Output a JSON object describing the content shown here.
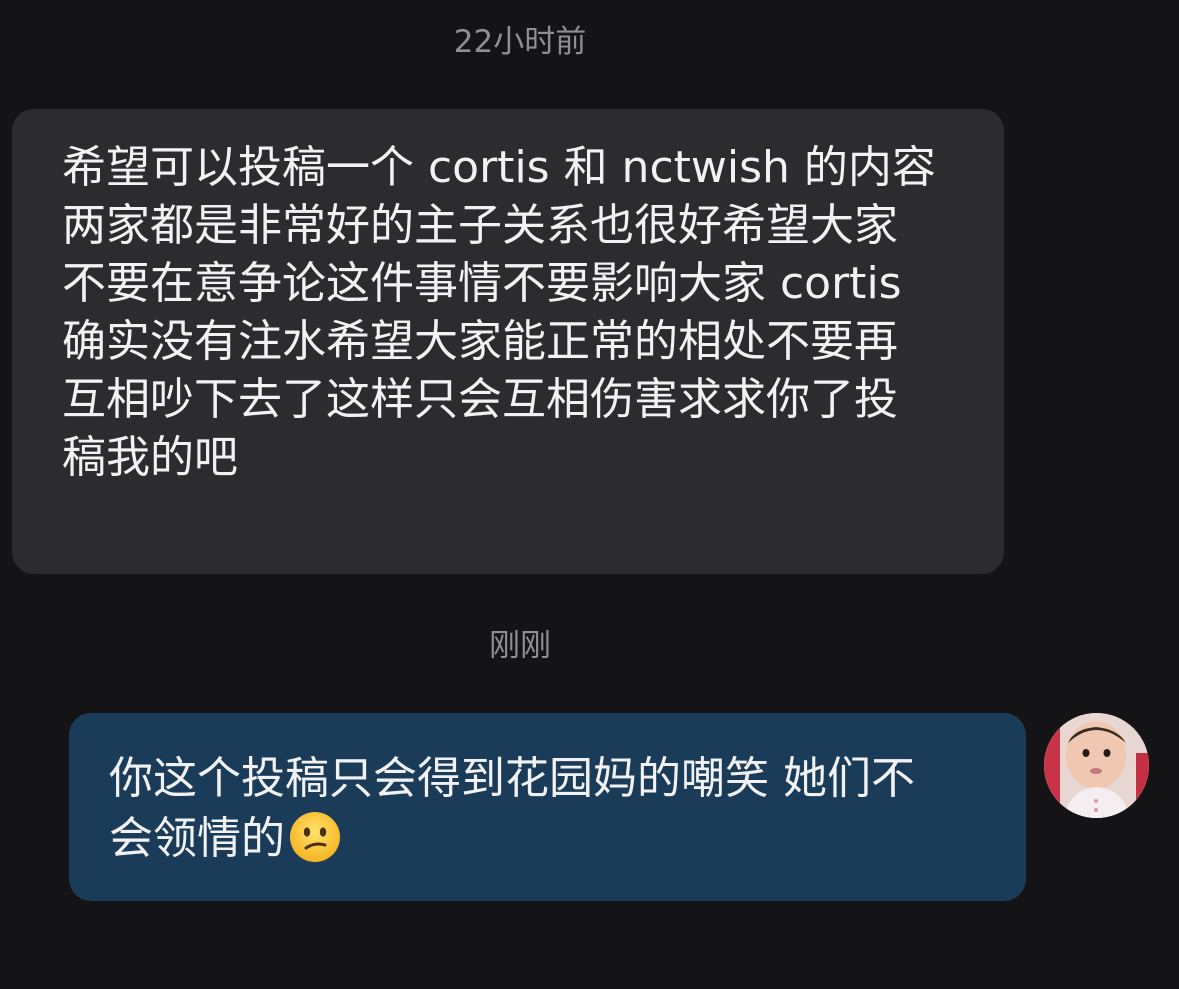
{
  "chat": {
    "timestamp_1": "22小时前",
    "incoming_message": {
      "lines": [
        "希望可以投稿一个 cortis 和 nctwish 的内容",
        "两家都是非常好的主子关系也很好希望大家",
        "不要在意争论这件事情不要影响大家 cortis",
        "确实没有注水希望大家能正常的相处不要再",
        "互相吵下去了这样只会互相伤害求求你了投",
        "稿我的吧"
      ]
    },
    "timestamp_2": "刚刚",
    "outgoing_message": {
      "line_1": "你这个投稿只会得到花园妈的嘲笑 她们不",
      "line_2": "会领情的",
      "emoji": "confused-face-emoji"
    },
    "avatar": "baby-photo-avatar"
  },
  "colors": {
    "background": "#141416",
    "incoming_bubble": "#2c2c2e",
    "outgoing_bubble": "#1a3c59",
    "timestamp_text": "#8e8e93",
    "message_text": "#f2f2f4"
  }
}
